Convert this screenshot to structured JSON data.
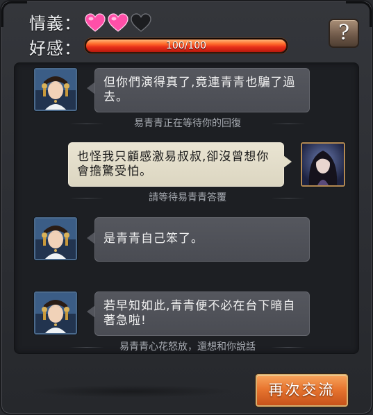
{
  "header": {
    "loyalty_label": "情義：",
    "favor_label": "好感：",
    "hearts": {
      "filled": 2,
      "total": 3
    },
    "favor_bar": {
      "value": 100,
      "max": 100,
      "text": "100/100"
    },
    "help_label": "?"
  },
  "dialogue": [
    {
      "speaker": "npc",
      "text": "但你們演得真了,竟連青青也騙了過去。",
      "status": "易青青正在等待你的回復"
    },
    {
      "speaker": "player",
      "text": "也怪我只顧感激易叔叔,卻沒曾想你會擔驚受怕。",
      "status": "請等待易青青答覆"
    },
    {
      "speaker": "npc",
      "text": "是青青自己笨了。",
      "status": ""
    },
    {
      "speaker": "npc",
      "text": "若早知如此,青青便不必在台下暗自著急啦!",
      "status": "易青青心花怒放，還想和你說話"
    }
  ],
  "footer": {
    "again_label": "再次交流"
  },
  "colors": {
    "heart_pink": "#ff4fa8",
    "bar_red": "#e8301a",
    "button_orange": "#e87630"
  },
  "icons": [
    "heart-filled-icon",
    "heart-empty-icon",
    "help-icon"
  ]
}
